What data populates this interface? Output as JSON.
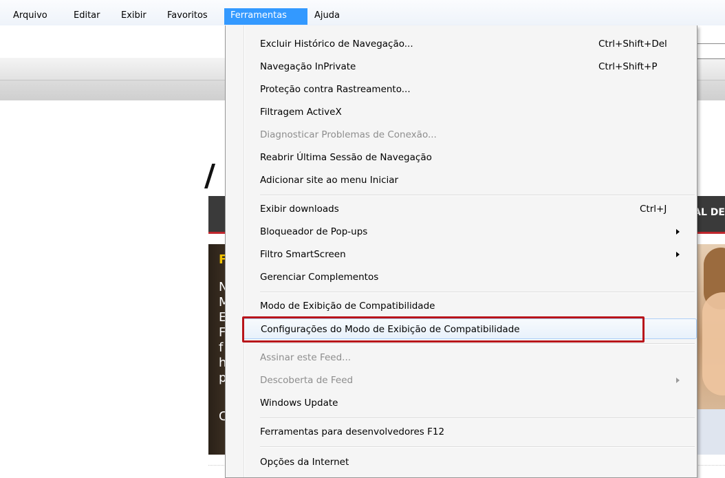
{
  "menubar": {
    "items": [
      "Arquivo",
      "Editar",
      "Exibir",
      "Favoritos",
      "Ferramentas",
      "Ajuda"
    ]
  },
  "page": {
    "banner_fragment": "AL DE",
    "left_letters": [
      "F",
      "N",
      "M",
      "E",
      "F",
      "f",
      "h",
      "p",
      "C"
    ]
  },
  "menu": {
    "items": [
      {
        "label": "Excluir Histórico de Navegação...",
        "shortcut": "Ctrl+Shift+Del"
      },
      {
        "label": "Navegação InPrivate",
        "shortcut": "Ctrl+Shift+P"
      },
      {
        "label": "Proteção contra Rastreamento...",
        "shortcut": ""
      },
      {
        "label": "Filtragem ActiveX",
        "shortcut": ""
      },
      {
        "label": "Diagnosticar Problemas de Conexão...",
        "shortcut": ""
      },
      {
        "label": "Reabrir Última Sessão de Navegação",
        "shortcut": ""
      },
      {
        "label": "Adicionar site ao menu Iniciar",
        "shortcut": ""
      },
      {
        "label": "Exibir downloads",
        "shortcut": "Ctrl+J"
      },
      {
        "label": "Bloqueador de Pop-ups",
        "shortcut": ""
      },
      {
        "label": "Filtro SmartScreen",
        "shortcut": ""
      },
      {
        "label": "Gerenciar Complementos",
        "shortcut": ""
      },
      {
        "label": "Modo de Exibição de Compatibilidade",
        "shortcut": ""
      },
      {
        "label": "Configurações do Modo de Exibição de Compatibilidade",
        "shortcut": ""
      },
      {
        "label": "Assinar este Feed...",
        "shortcut": ""
      },
      {
        "label": "Descoberta de Feed",
        "shortcut": ""
      },
      {
        "label": "Windows Update",
        "shortcut": ""
      },
      {
        "label": "Ferramentas para desenvolvedores F12",
        "shortcut": ""
      },
      {
        "label": "Opções da Internet",
        "shortcut": ""
      }
    ]
  },
  "colors": {
    "menu_active": "#3399ff",
    "highlight_box": "#b8141a",
    "disabled_text": "#8d8d8d"
  }
}
